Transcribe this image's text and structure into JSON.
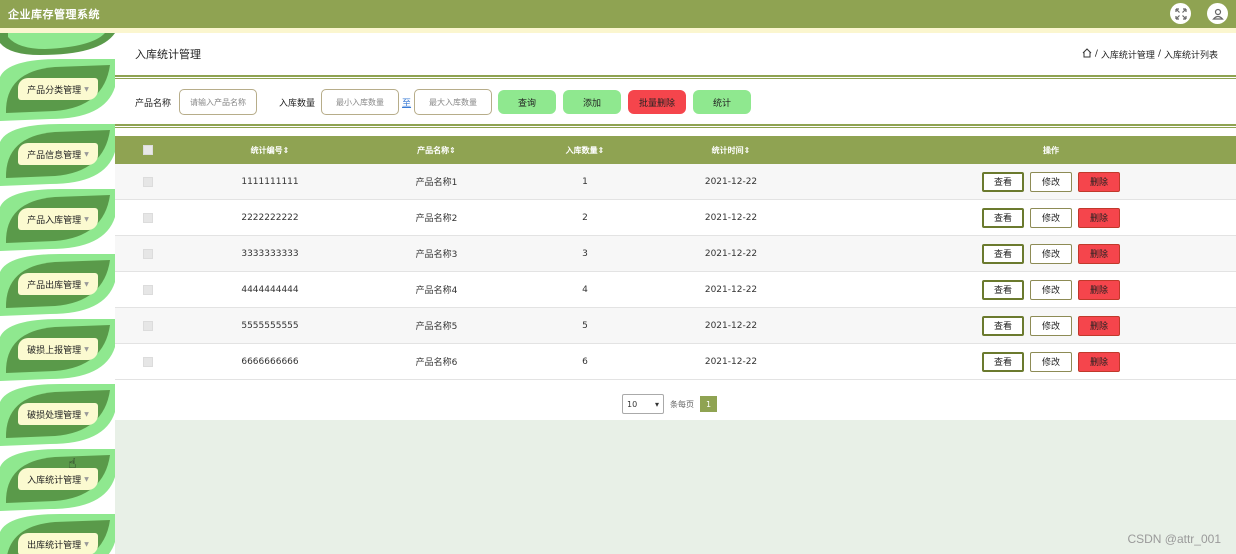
{
  "app": {
    "title": "企业库存管理系统"
  },
  "topbar": {
    "icons": [
      "fullscreen-icon",
      "user-icon"
    ]
  },
  "sidebar": {
    "items": [
      {
        "label": "产品分类管理"
      },
      {
        "label": "产品信息管理"
      },
      {
        "label": "产品入库管理"
      },
      {
        "label": "产品出库管理"
      },
      {
        "label": "破损上报管理"
      },
      {
        "label": "破损处理管理"
      },
      {
        "label": "入库统计管理"
      },
      {
        "label": "出库统计管理"
      }
    ]
  },
  "page": {
    "title": "入库统计管理",
    "breadcrumb": {
      "sep": "/",
      "level1": "入库统计管理",
      "level2": "入库统计列表"
    }
  },
  "search": {
    "name_label": "产品名称",
    "name_placeholder": "请输入产品名称",
    "qty_label": "入库数量",
    "min_placeholder": "最小入库数量",
    "to_label": "至",
    "max_placeholder": "最大入库数量",
    "buttons": {
      "query": "查询",
      "add": "添加",
      "batch_delete": "批量删除",
      "stats": "统计"
    }
  },
  "table": {
    "headers": {
      "id": "统计编号",
      "name": "产品名称",
      "qty": "入库数量",
      "date": "统计时间",
      "actions": "操作"
    },
    "sort_glyph": "⇕",
    "rows": [
      {
        "id": "1111111111",
        "name": "产品名称1",
        "qty": "1",
        "date": "2021-12-22"
      },
      {
        "id": "2222222222",
        "name": "产品名称2",
        "qty": "2",
        "date": "2021-12-22"
      },
      {
        "id": "3333333333",
        "name": "产品名称3",
        "qty": "3",
        "date": "2021-12-22"
      },
      {
        "id": "4444444444",
        "name": "产品名称4",
        "qty": "4",
        "date": "2021-12-22"
      },
      {
        "id": "5555555555",
        "name": "产品名称5",
        "qty": "5",
        "date": "2021-12-22"
      },
      {
        "id": "6666666666",
        "name": "产品名称6",
        "qty": "6",
        "date": "2021-12-22"
      }
    ],
    "actions": {
      "view": "查看",
      "edit": "修改",
      "delete": "删除"
    }
  },
  "pager": {
    "page_size": "10",
    "per_page_text": "条每页",
    "current_page": "1"
  },
  "watermark": "CSDN @attr_001",
  "colors": {
    "primary": "#8fa352",
    "green_button": "#8fe88f",
    "red_button": "#f5454c",
    "leaf_dark": "#5a9a4a",
    "leaf_light": "#8fe88f"
  }
}
